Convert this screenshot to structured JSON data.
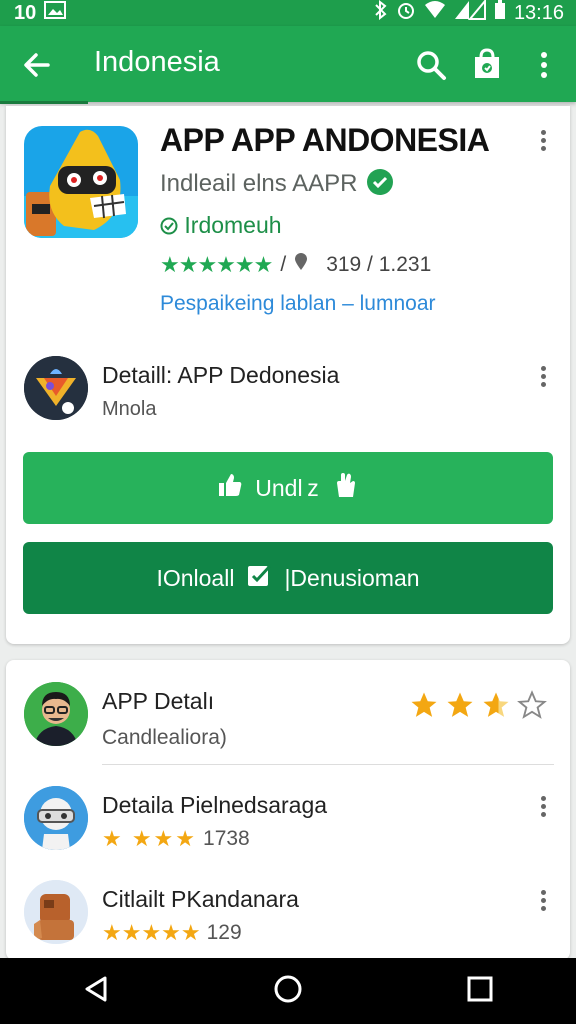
{
  "status_bar": {
    "left_text": "10",
    "time": "13:16"
  },
  "app_bar": {
    "title": "Indonesia"
  },
  "app": {
    "title": "APP APP ANDONESIA",
    "developer": "Indleail elns AAPR",
    "category": "Irdomeuh",
    "rating_separator": "/",
    "rating_counts": "319 / 1.231",
    "link_text": "Pespaikeing lablan – lumnoar"
  },
  "subapp": {
    "title": "Detaill: APP Dedonesia",
    "subtitle": "Mnola"
  },
  "buttons": {
    "primary_label": "Undl z",
    "secondary_label_left": "IOnloall",
    "secondary_label_right": "|Denusioman"
  },
  "reviews": [
    {
      "title": "APP Detalı",
      "subtitle": "Candlealiora)"
    },
    {
      "title": "Detaila Pielnedsaraga",
      "count": "1738"
    },
    {
      "title": "Citlailt PKandanara",
      "count": "129"
    }
  ],
  "colors": {
    "accent": "#20a853",
    "dark_green": "#108547",
    "star": "#f3a712",
    "link": "#2d8ad9"
  },
  "icons": [
    "back-arrow-icon",
    "search-icon",
    "store-bag-icon",
    "more-vert-icon",
    "verified-check-icon",
    "thumbs-up-icon",
    "hand-icon",
    "check-box-icon"
  ]
}
